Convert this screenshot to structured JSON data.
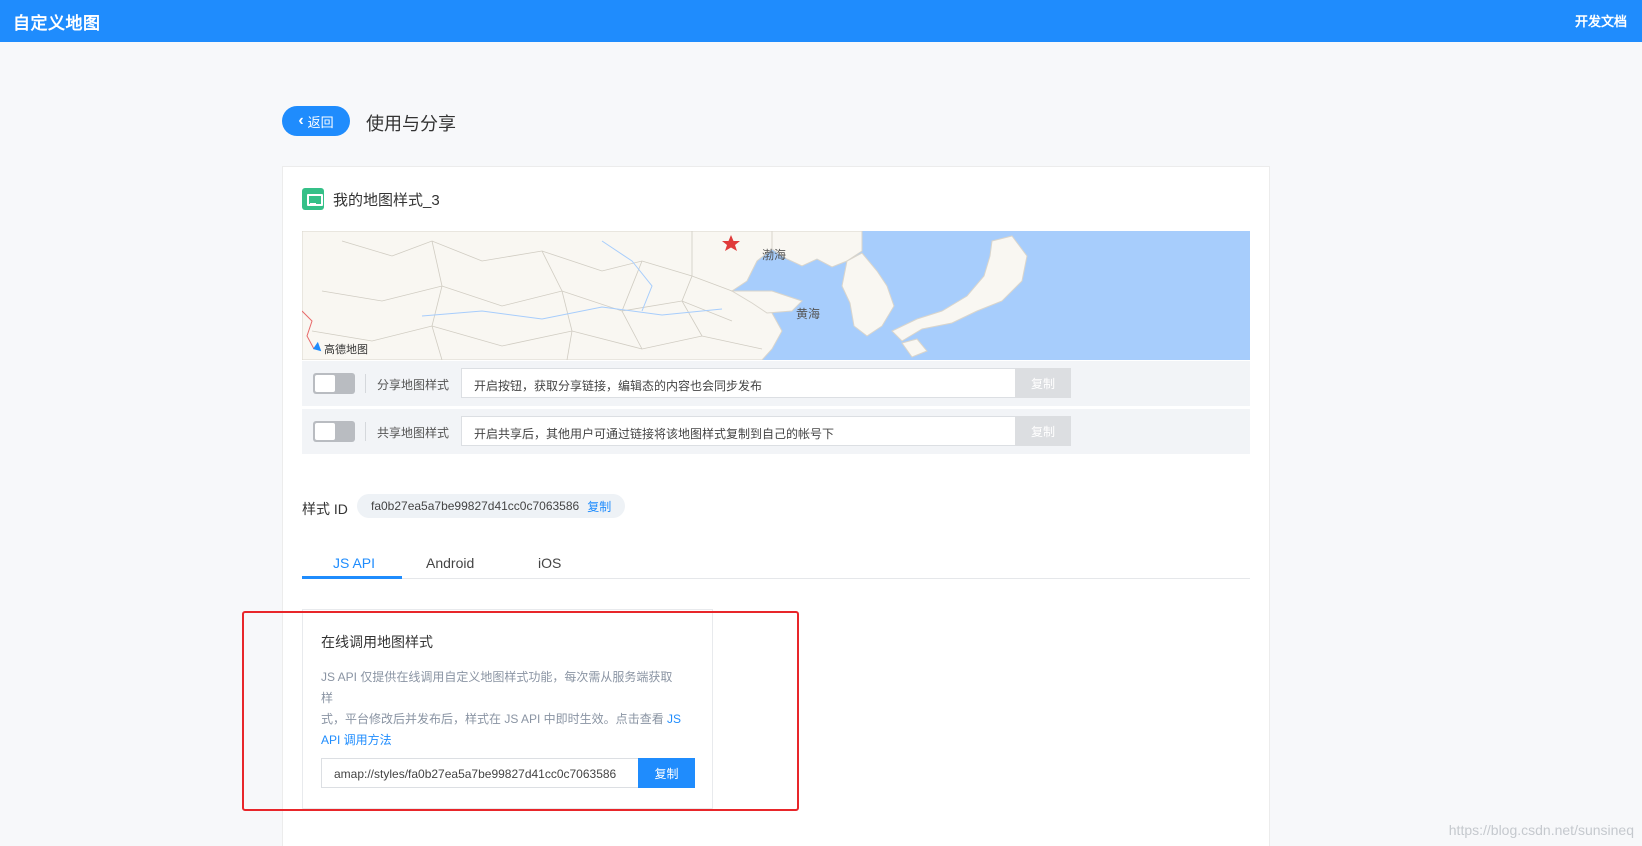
{
  "header": {
    "logo_text": "自定义地图",
    "docs_link": "开发文档",
    "bg_color": "#1f8cfd"
  },
  "page": {
    "back_label": "返回",
    "back_icon": "chevron-left-icon",
    "title": "使用与分享"
  },
  "map_style": {
    "icon": "monitor-icon",
    "name": "我的地图样式_3",
    "preview": {
      "labels": [
        "渤海",
        "黄海"
      ],
      "brand": "高德地图",
      "marker_icon": "star-icon",
      "land_color": "#f9f7f2",
      "water_color": "#a7cdfc"
    }
  },
  "share_rows": [
    {
      "label": "分享地图样式",
      "text": "开启按钮，获取分享链接，编辑态的内容也会同步发布",
      "copy_label": "复制",
      "enabled": false
    },
    {
      "label": "共享地图样式",
      "text": "开启共享后，其他用户可通过链接将该地图样式复制到自己的帐号下",
      "copy_label": "复制",
      "enabled": false
    }
  ],
  "style_id": {
    "label": "样式 ID",
    "value": "fa0b27ea5a7be99827d41cc0c7063586",
    "copy_label": "复制"
  },
  "tabs": [
    {
      "label": "JS API",
      "active": true
    },
    {
      "label": "Android",
      "active": false
    },
    {
      "label": "iOS",
      "active": false
    }
  ],
  "js_api_panel": {
    "title": "在线调用地图样式",
    "desc_lines": [
      "JS API 仅提供在线调用自定义地图样式功能，每次需从服务端获取样",
      "式，平台修改后并发布后，样式在 JS API 中即时生效。点击查看 ",
      " 调用方法"
    ],
    "desc_link_lines": [
      "JS",
      "API"
    ],
    "url_value": "amap://styles/fa0b27ea5a7be99827d41cc0c7063586",
    "copy_label": "复制"
  },
  "watermark": "https://blog.csdn.net/sunsineq"
}
